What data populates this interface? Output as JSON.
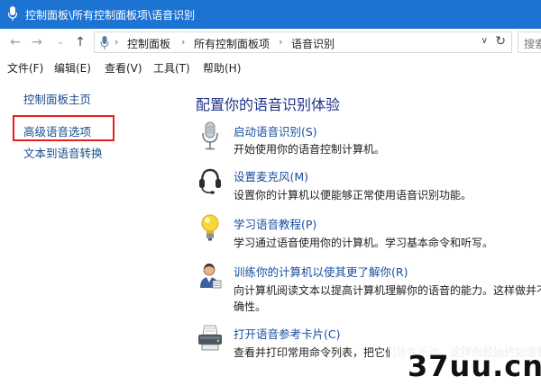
{
  "window": {
    "title": "控制面板\\所有控制面板项\\语音识别"
  },
  "address": {
    "crumbs": [
      "控制面板",
      "所有控制面板项",
      "语音识别"
    ],
    "search_placeholder": "搜索"
  },
  "menu": [
    "文件(F)",
    "编辑(E)",
    "查看(V)",
    "工具(T)",
    "帮助(H)"
  ],
  "sidebar": {
    "items": [
      {
        "label": "控制面板主页"
      },
      {
        "label": "高级语音选项"
      },
      {
        "label": "文本到语音转换"
      }
    ]
  },
  "main": {
    "heading": "配置你的语音识别体验",
    "tasks": [
      {
        "icon": "microphone-icon",
        "title": "启动语音识别(S)",
        "desc": "开始使用你的语音控制计算机。"
      },
      {
        "icon": "headset-icon",
        "title": "设置麦克风(M)",
        "desc": "设置你的计算机以便能够正常使用语音识别功能。"
      },
      {
        "icon": "lightbulb-icon",
        "title": "学习语音教程(P)",
        "desc": "学习通过语音使用你的计算机。学习基本命令和听写。"
      },
      {
        "icon": "user-train-icon",
        "title": "训练你的计算机以使其更了解你(R)",
        "desc": "向计算机阅读文本以提高计算机理解你的语音的能力。这样做并不",
        "desc2": "确性。"
      },
      {
        "icon": "printer-icon",
        "title": "打开语音参考卡片(C)",
        "desc": "查看并打印常用命令列表，把它们放在手边，这样你就始终知道要"
      }
    ]
  },
  "watermark": {
    "text": "37uu.cn"
  },
  "colors": {
    "titlebar": "#1c73d2",
    "link": "#1a4ea0",
    "heading": "#1e3287",
    "highlight_box": "#e81e1e"
  }
}
